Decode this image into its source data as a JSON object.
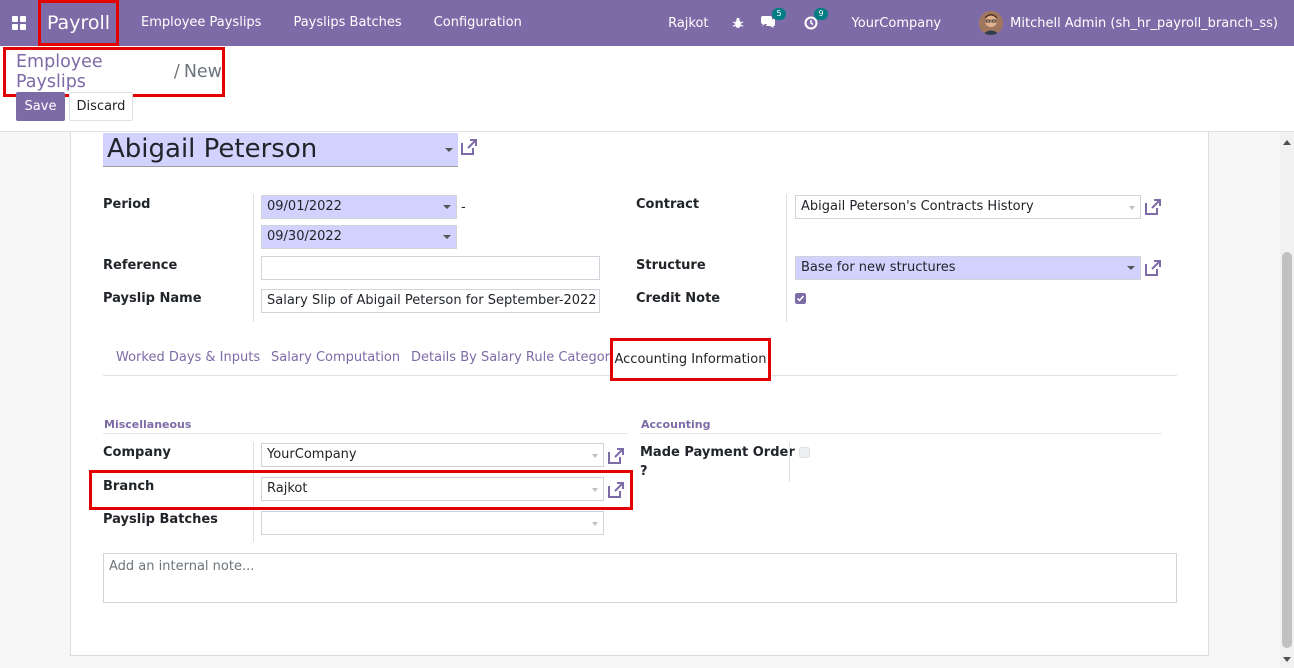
{
  "navbar": {
    "app_name": "Payroll",
    "menu": [
      "Employee Payslips",
      "Payslips Batches",
      "Configuration"
    ],
    "branch": "Rajkot",
    "messages_count": "5",
    "activities_count": "9",
    "company": "YourCompany",
    "user": "Mitchell Admin (sh_hr_payroll_branch_ss)"
  },
  "breadcrumb": {
    "parent": "Employee Payslips",
    "separator": "/",
    "current": "New"
  },
  "buttons": {
    "save": "Save",
    "discard": "Discard"
  },
  "form": {
    "employee": "Abigail Peterson",
    "period_label": "Period",
    "date_from": "09/01/2022",
    "date_separator": "-",
    "date_to": "09/30/2022",
    "reference_label": "Reference",
    "reference_value": "",
    "payslip_name_label": "Payslip Name",
    "payslip_name_value": "Salary Slip of Abigail Peterson for September-2022",
    "contract_label": "Contract",
    "contract_value": "Abigail Peterson's Contracts History",
    "structure_label": "Structure",
    "structure_value": "Base for new structures",
    "credit_note_label": "Credit Note",
    "credit_note_checked": true
  },
  "tabs": [
    "Worked Days & Inputs",
    "Salary Computation",
    "Details By Salary Rule Category",
    "Accounting Information"
  ],
  "accounting_tab": {
    "misc_title": "Miscellaneous",
    "accounting_title": "Accounting",
    "company_label": "Company",
    "company_value": "YourCompany",
    "branch_label": "Branch",
    "branch_value": "Rajkot",
    "payslip_batches_label": "Payslip Batches",
    "payslip_batches_value": "",
    "made_payment_order_label_line1": "Made Payment Order",
    "made_payment_order_label_line2": "?",
    "made_payment_order_checked": false
  },
  "note": {
    "placeholder": "Add an internal note..."
  },
  "colors": {
    "brand": "#7c6ba6",
    "highlight": "#e50000",
    "required_field": "#d2d2ff"
  }
}
